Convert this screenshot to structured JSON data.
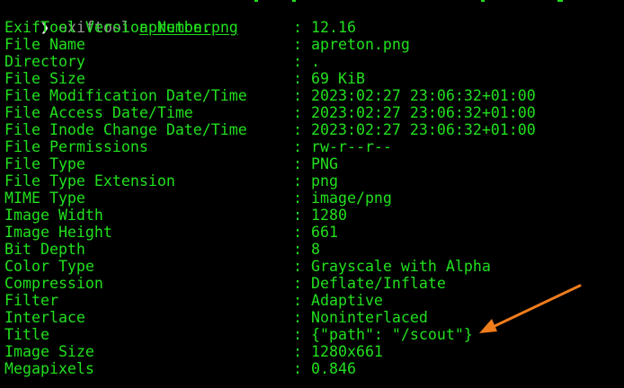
{
  "terminal": {
    "prompt_symbol": "❯",
    "command": "exiftool",
    "argument": "apreton.png",
    "separator": ":",
    "rows": [
      {
        "key": "ExifTool Version Number",
        "value": "12.16"
      },
      {
        "key": "File Name",
        "value": "apreton.png"
      },
      {
        "key": "Directory",
        "value": "."
      },
      {
        "key": "File Size",
        "value": "69 KiB"
      },
      {
        "key": "File Modification Date/Time",
        "value": "2023:02:27 23:06:32+01:00"
      },
      {
        "key": "File Access Date/Time",
        "value": "2023:02:27 23:06:32+01:00"
      },
      {
        "key": "File Inode Change Date/Time",
        "value": "2023:02:27 23:06:32+01:00"
      },
      {
        "key": "File Permissions",
        "value": "rw-r--r--"
      },
      {
        "key": "File Type",
        "value": "PNG"
      },
      {
        "key": "File Type Extension",
        "value": "png"
      },
      {
        "key": "MIME Type",
        "value": "image/png"
      },
      {
        "key": "Image Width",
        "value": "1280"
      },
      {
        "key": "Image Height",
        "value": "661"
      },
      {
        "key": "Bit Depth",
        "value": "8"
      },
      {
        "key": "Color Type",
        "value": "Grayscale with Alpha"
      },
      {
        "key": "Compression",
        "value": "Deflate/Inflate"
      },
      {
        "key": "Filter",
        "value": "Adaptive"
      },
      {
        "key": "Interlace",
        "value": "Noninterlaced"
      },
      {
        "key": "Title",
        "value": "{\"path\": \"/scout\"}"
      },
      {
        "key": "Image Size",
        "value": "1280x661"
      },
      {
        "key": "Megapixels",
        "value": "0.846"
      }
    ]
  },
  "colors": {
    "background": "#000000",
    "text": "#22e01e",
    "command": "#9a9a9a",
    "annotation_arrow": "#f07d1c"
  },
  "annotation": {
    "icon": "arrow-pointer-icon",
    "points_to": "Title"
  }
}
